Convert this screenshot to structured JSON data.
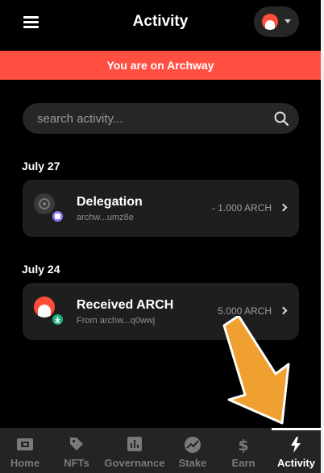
{
  "header": {
    "title": "Activity",
    "menu_icon": "hamburger-icon",
    "account_icon": "archway-logo"
  },
  "banner": {
    "text": "You are on Archway",
    "color": "#ff4f42"
  },
  "search": {
    "placeholder": "search activity...",
    "value": ""
  },
  "groups": [
    {
      "date": "July 27",
      "items": [
        {
          "title": "Delegation",
          "subtitle": "archw...umz8e",
          "amount": "- 1.000 ARCH",
          "badge": "stake-badge-icon"
        }
      ]
    },
    {
      "date": "July 24",
      "items": [
        {
          "title": "Received ARCH",
          "subtitle": "From archw...q0wwj",
          "amount": "5.000 ARCH",
          "badge": "download-badge-icon"
        }
      ]
    }
  ],
  "nav": {
    "items": [
      {
        "label": "Home",
        "icon": "wallet-icon"
      },
      {
        "label": "NFTs",
        "icon": "tag-icon"
      },
      {
        "label": "Governance",
        "icon": "bar-chart-icon"
      },
      {
        "label": "Stake",
        "icon": "trend-icon"
      },
      {
        "label": "Earn",
        "icon": "dollar-icon"
      },
      {
        "label": "Activity",
        "icon": "lightning-icon"
      }
    ],
    "active": "Activity"
  },
  "colors": {
    "accent": "#ff4f42",
    "background": "#000000",
    "card": "#1e1e1e",
    "annotation_arrow": "#f0a030"
  }
}
